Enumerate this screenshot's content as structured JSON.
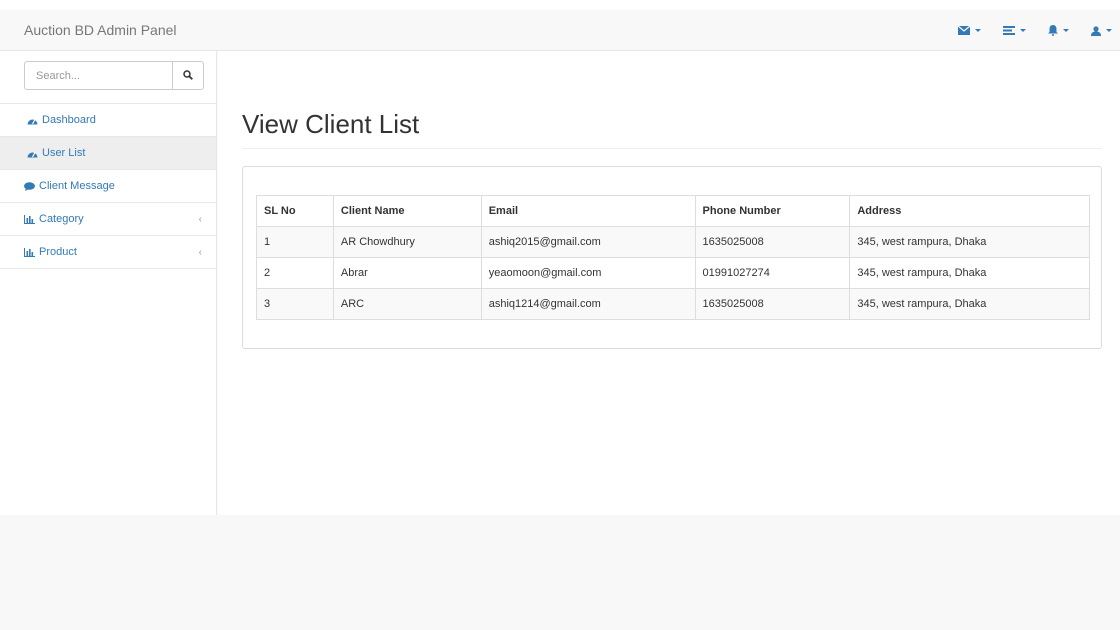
{
  "navbar": {
    "brand": "Auction BD Admin Panel",
    "icons": [
      "envelope-icon",
      "tasks-icon",
      "bell-icon",
      "user-icon"
    ],
    "accent": "#337ab7"
  },
  "sidebar": {
    "search": {
      "placeholder": "Search...",
      "value": ""
    },
    "items": [
      {
        "label": "Dashboard",
        "icon": "dashboard-icon",
        "active": false,
        "has_arrow": false
      },
      {
        "label": "User List",
        "icon": "dashboard-icon",
        "active": true,
        "has_arrow": false
      },
      {
        "label": "Client Message",
        "icon": "comment-icon",
        "active": false,
        "has_arrow": false
      },
      {
        "label": "Category",
        "icon": "bar-chart-icon",
        "active": false,
        "has_arrow": true
      },
      {
        "label": "Product",
        "icon": "bar-chart-icon",
        "active": false,
        "has_arrow": true
      }
    ],
    "arrow_glyph": "‹"
  },
  "main": {
    "title": "View Client List",
    "table": {
      "headers": [
        "SL No",
        "Client Name",
        "Email",
        "Phone Number",
        "Address"
      ],
      "rows": [
        [
          "1",
          "AR Chowdhury",
          "ashiq2015@gmail.com",
          "1635025008",
          "345, west rampura, Dhaka"
        ],
        [
          "2",
          "Abrar",
          "yeaomoon@gmail.com",
          "01991027274",
          "345, west rampura, Dhaka"
        ],
        [
          "3",
          "ARC",
          "ashiq1214@gmail.com",
          "1635025008",
          "345, west rampura, Dhaka"
        ]
      ]
    }
  }
}
